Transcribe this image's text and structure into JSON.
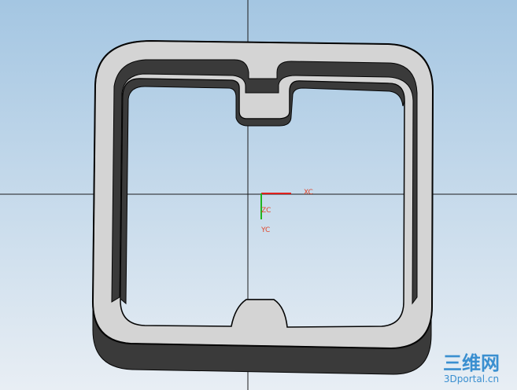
{
  "viewport": {
    "colors": {
      "background_top": "#a4c6e2",
      "background_bottom": "#e8eef4",
      "crosshair": "#1c1c1c",
      "part_face": "#d4d4d4",
      "part_wall_dark": "#3a3a3a",
      "part_wall_darker": "#1f1f1f",
      "part_edge": "#050505",
      "axis_x": "#e0201c",
      "axis_y": "#1fb51f",
      "axis_label": "#e0452a",
      "watermark": "#3a8fd0"
    }
  },
  "wcs": {
    "x_label": "XC",
    "z_label": "ZC",
    "y_label": "YC"
  },
  "watermark": {
    "logo_text": "三维网",
    "url": "3Dportal.cn"
  }
}
